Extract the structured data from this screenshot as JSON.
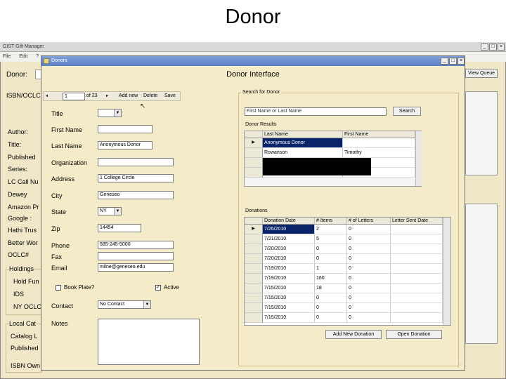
{
  "slide_title": "Donor",
  "bg": {
    "title": "GIST Gift Manager",
    "menu": [
      "File",
      "Edit",
      "?"
    ],
    "donor_label": "Donor:",
    "view_queue": "View Queue",
    "labels": [
      "ISBN/OCLC",
      "Author:",
      "Title:",
      "Published",
      "Series:",
      "LC Call Nu",
      "Dewey",
      "Amazon Pr",
      "Google :",
      "Hathi Trus",
      "Better Wor",
      "OCLC#"
    ],
    "group_holdings": "Holdings",
    "holdings_items": [
      "Hold Fun",
      "IDS",
      "NY OCLC"
    ],
    "group_local": "Local Cat",
    "local_items": [
      "Catalog L",
      "Published",
      "ISBN Own"
    ]
  },
  "dlg": {
    "title": "Donors",
    "heading": "Donor Interface",
    "nav": {
      "position": "1",
      "of": "of 23",
      "add": "Add new",
      "delete": "Delete",
      "save": "Save"
    },
    "form": {
      "title_label": "Title",
      "first_label": "First Name",
      "last_label": "Last Name",
      "last_value": "Anonymous Donor",
      "org_label": "Organization",
      "address_label": "Address",
      "address_value": "1 College Circle",
      "city_label": "City",
      "city_value": "Geneseo",
      "state_label": "State",
      "state_value": "NY",
      "zip_label": "Zip",
      "zip_value": "14454",
      "phone_label": "Phone",
      "phone_value": "585-245-5000",
      "fax_label": "Fax",
      "email_label": "Email",
      "email_value": "milne@geneseo.edu",
      "bookplate_label": "Book Plate?",
      "active_label": "Active",
      "contact_label": "Contact",
      "contact_value": "No Contact",
      "notes_label": "Notes"
    },
    "search": {
      "group": "Search for Donor",
      "placeholder": "First Name or Last Name",
      "button": "Search",
      "results_label": "Donor Results",
      "columns": [
        "Last Name",
        "First Name"
      ],
      "rows": [
        [
          "Anonymous Donor",
          ""
        ],
        [
          "Rowanson",
          "Timothy"
        ],
        [
          "",
          ""
        ],
        [
          "",
          ""
        ]
      ]
    },
    "donations": {
      "label": "Donations",
      "columns": [
        "Donation Date",
        "# Items",
        "# of Letters",
        "Letter Sent Date"
      ],
      "rows": [
        [
          "7/26/2010",
          "2",
          "0",
          ""
        ],
        [
          "7/21/2010",
          "5",
          "0",
          ""
        ],
        [
          "7/20/2010",
          "0",
          "0",
          ""
        ],
        [
          "7/20/2010",
          "0",
          "0",
          ""
        ],
        [
          "7/19/2010",
          "1",
          "0",
          ""
        ],
        [
          "7/19/2010",
          "160",
          "0",
          ""
        ],
        [
          "7/15/2010",
          "18",
          "0",
          ""
        ],
        [
          "7/15/2010",
          "0",
          "0",
          ""
        ],
        [
          "7/15/2010",
          "0",
          "0",
          ""
        ],
        [
          "7/15/2010",
          "0",
          "0",
          ""
        ]
      ],
      "add_button": "Add New Donation",
      "open_button": "Open Donation"
    }
  }
}
